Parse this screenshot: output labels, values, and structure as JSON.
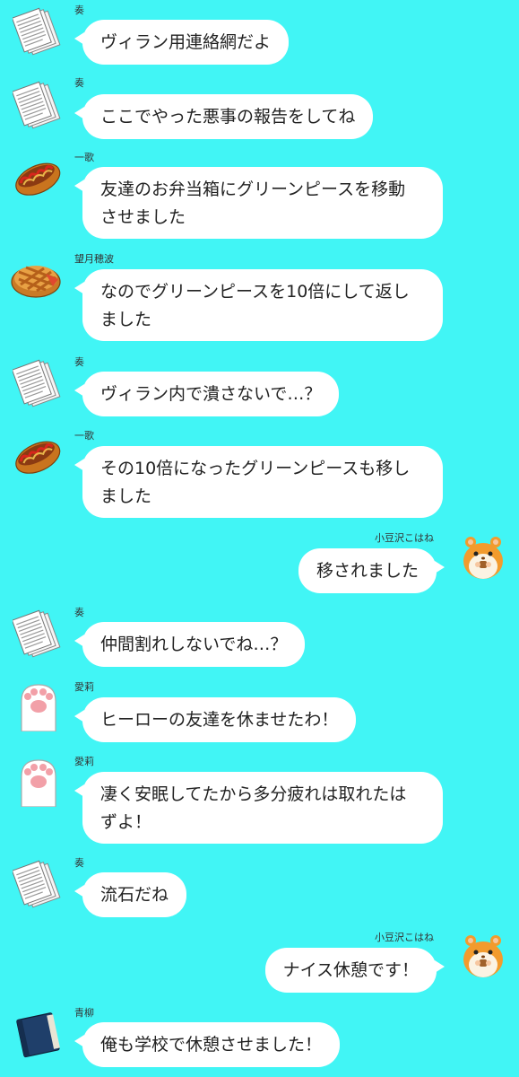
{
  "messages": [
    {
      "sender": "奏",
      "text": "ヴィラン用連絡網だよ"
    },
    {
      "sender": "奏",
      "text": "ここでやった悪事の報告をしてね"
    },
    {
      "sender": "一歌",
      "text": "友達のお弁当箱にグリーンピースを移動\nさせました"
    },
    {
      "sender": "望月穂波",
      "text": "なのでグリーンピースを10倍にして返し\nました"
    },
    {
      "sender": "奏",
      "text": "ヴィラン内で潰さないで…？"
    },
    {
      "sender": "一歌",
      "text": "その10倍になったグリーンピースも移し\nました"
    },
    {
      "sender": "小豆沢こはね",
      "text": "移されました"
    },
    {
      "sender": "奏",
      "text": "仲間割れしないでね…？"
    },
    {
      "sender": "愛莉",
      "text": "ヒーローの友達を休ませたわ！"
    },
    {
      "sender": "愛莉",
      "text": "凄く安眠してたから多分疲れは取れたは\nずよ！"
    },
    {
      "sender": "奏",
      "text": "流石だね"
    },
    {
      "sender": "小豆沢こはね",
      "text": "ナイス休憩です！"
    },
    {
      "sender": "青柳",
      "text": "俺も学校で休憩させました！"
    }
  ],
  "avatars": {
    "kanade": "documents-icon",
    "ichika": "bread-icon",
    "honami": "pie-icon",
    "kohane": "hamster-icon",
    "airi": "paw-icon",
    "aoyagi": "book-icon"
  }
}
